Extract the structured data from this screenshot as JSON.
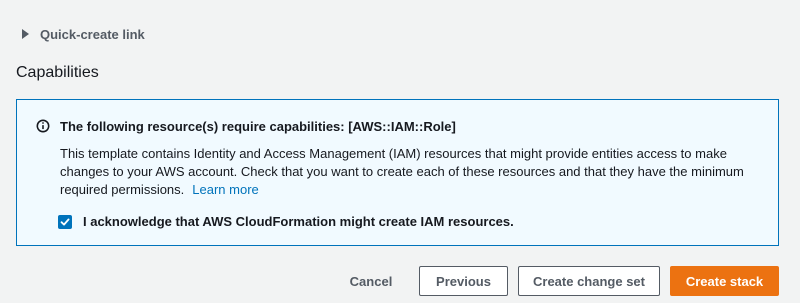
{
  "quick_create": {
    "label": "Quick-create link",
    "expanded": false,
    "icon": "caret-right-icon"
  },
  "capabilities": {
    "title": "Capabilities",
    "alert": {
      "type": "info",
      "icon": "info-icon",
      "accent_color": "#0073bb",
      "title": "The following resource(s) require capabilities: [AWS::IAM::Role]",
      "body": "This template contains Identity and Access Management (IAM) resources that might provide entities access to make changes to your AWS account. Check that you want to create each of these resources and that they have the minimum required permissions.",
      "link_label": "Learn more",
      "acknowledge_label": "I acknowledge that AWS CloudFormation might create IAM resources.",
      "acknowledged": true
    }
  },
  "actions": {
    "cancel_label": "Cancel",
    "previous_label": "Previous",
    "change_set_label": "Create change set",
    "create_stack_label": "Create stack",
    "primary_color": "#ec7211"
  }
}
